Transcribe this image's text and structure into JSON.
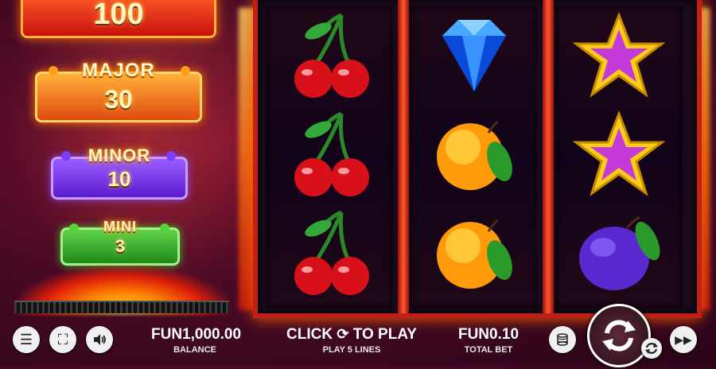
{
  "jackpots": {
    "grand": {
      "value": "100"
    },
    "major": {
      "label": "MAJOR",
      "value": "30"
    },
    "minor": {
      "label": "MINOR",
      "value": "10"
    },
    "mini": {
      "label": "MINI",
      "value": "3"
    }
  },
  "reels": [
    [
      "cherry",
      "cherry",
      "cherry"
    ],
    [
      "diamond",
      "orange",
      "orange"
    ],
    [
      "star",
      "star",
      "plum"
    ]
  ],
  "bottom_bar": {
    "balance_value": "FUN1,000.00",
    "balance_label": "BALANCE",
    "prompt_text_before": "CLICK",
    "prompt_text_after": "TO PLAY",
    "lines_text": "PLAY 5 LINES",
    "total_bet_value": "FUN0.10",
    "total_bet_label": "TOTAL BET"
  },
  "icons": {
    "menu": "menu-icon",
    "fullscreen": "fullscreen-icon",
    "sound": "speaker-icon",
    "bet": "coin-stack-icon",
    "spin": "refresh-icon",
    "autoplay": "autoplay-icon",
    "turbo": "fast-forward-icon"
  },
  "colors": {
    "grand": "#d8180c",
    "major": "#f07a1a",
    "minor": "#6a2ae0",
    "mini": "#2a9a22",
    "reel_frame": "#c02018"
  }
}
